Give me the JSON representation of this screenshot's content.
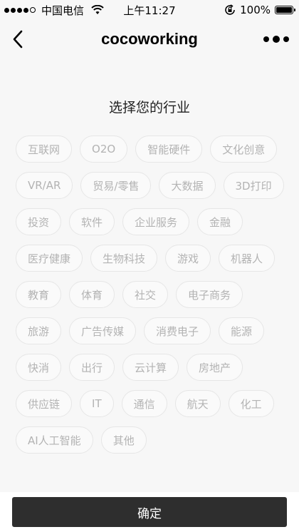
{
  "status_bar": {
    "carrier": "中国电信",
    "time": "上午11:27",
    "battery": "100%",
    "signal_bars_filled": 4,
    "signal_bars_total": 5
  },
  "nav": {
    "title": "cocoworking",
    "back_icon": "chevron-left-icon",
    "more_icon": "more-dots-icon"
  },
  "page": {
    "heading": "选择您的行业"
  },
  "industries": [
    "互联网",
    "O2O",
    "智能硬件",
    "文化创意",
    "VR/AR",
    "贸易/零售",
    "大数据",
    "3D打印",
    "投资",
    "软件",
    "企业服务",
    "金融",
    "医疗健康",
    "生物科技",
    "游戏",
    "机器人",
    "教育",
    "体育",
    "社交",
    "电子商务",
    "旅游",
    "广告传媒",
    "消费电子",
    "能源",
    "快消",
    "出行",
    "云计算",
    "房地产",
    "供应链",
    "IT",
    "通信",
    "航天",
    "化工",
    "AI人工智能",
    "其他"
  ],
  "footer": {
    "confirm_label": "确定"
  },
  "colors": {
    "confirm_bg": "#2e2e2e",
    "tag_text": "#b3b3b3",
    "tag_border": "#e6e6e6"
  }
}
